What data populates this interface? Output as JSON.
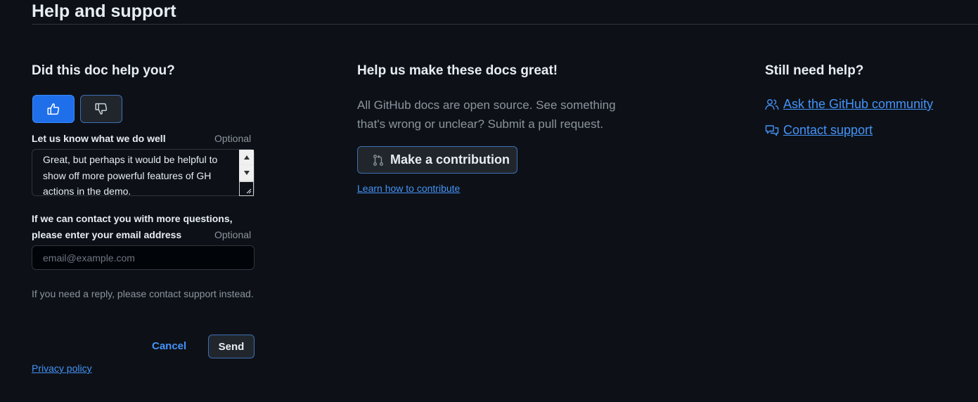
{
  "page": {
    "title": "Help and support"
  },
  "feedback": {
    "heading": "Did this doc help you?",
    "thumbs_up_icon": "thumbs-up-icon",
    "thumbs_down_icon": "thumbs-down-icon",
    "comment_label": "Let us know what we do well",
    "comment_optional": "Optional",
    "comment_value": "Great, but perhaps it would be helpful to show off more powerful features of GH actions in the demo.",
    "email_label_line1": "If we can contact you with more questions,",
    "email_label_line2": "please enter your email address",
    "email_optional": "Optional",
    "email_placeholder": "email@example.com",
    "email_value": "",
    "note": "If you need a reply, please contact support instead.",
    "cancel_label": "Cancel",
    "send_label": "Send",
    "privacy_label": "Privacy policy"
  },
  "contribute": {
    "heading": "Help us make these docs great!",
    "description": "All GitHub docs are open source. See something that's wrong or unclear? Submit a pull request.",
    "button_label": "Make a contribution",
    "button_icon": "git-pull-request-icon",
    "learn_label": "Learn how to contribute"
  },
  "support": {
    "heading": "Still need help?",
    "community_label": "Ask the GitHub community",
    "community_icon": "people-icon",
    "contact_label": "Contact support",
    "contact_icon": "comment-discussion-icon"
  },
  "colors": {
    "background": "#0d1117",
    "accent": "#1f6feb",
    "link": "#4493f8",
    "muted": "#8b949e"
  }
}
